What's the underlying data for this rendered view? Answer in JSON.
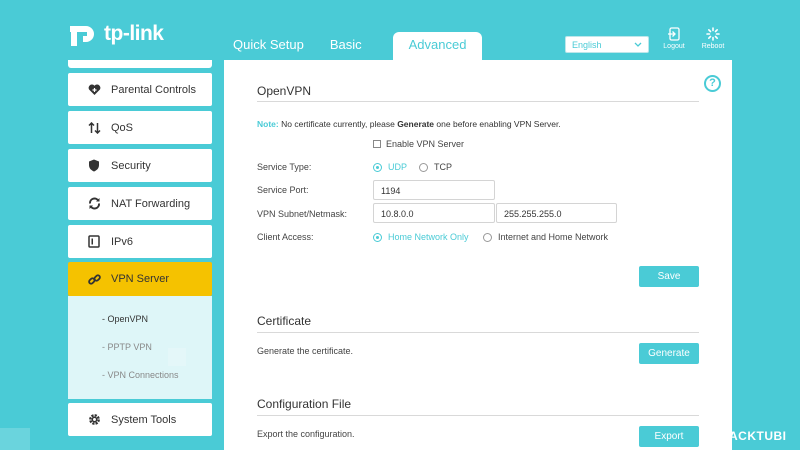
{
  "header": {
    "brand": "tp-link",
    "tabs": [
      {
        "label": "Quick Setup"
      },
      {
        "label": "Basic"
      },
      {
        "label": "Advanced"
      }
    ],
    "language": "English",
    "logout_label": "Logout",
    "reboot_label": "Reboot"
  },
  "sidebar": {
    "items": [
      {
        "label": "Parental Controls",
        "icon": "heart-icon"
      },
      {
        "label": "QoS",
        "icon": "arrows-updown-icon"
      },
      {
        "label": "Security",
        "icon": "shield-icon"
      },
      {
        "label": "NAT Forwarding",
        "icon": "refresh-icon"
      },
      {
        "label": "IPv6",
        "icon": "ipv6-icon"
      },
      {
        "label": "VPN Server",
        "icon": "link-icon"
      },
      {
        "label": "System Tools",
        "icon": "gear-icon"
      }
    ],
    "submenu": [
      {
        "label": "- OpenVPN"
      },
      {
        "label": "- PPTP VPN"
      },
      {
        "label": "- VPN Connections"
      }
    ]
  },
  "openvpn": {
    "title": "OpenVPN",
    "note_label": "Note:",
    "note_pre": "No certificate currently, please",
    "note_bold": "Generate",
    "note_post": "one before enabling VPN Server.",
    "enable_label": "Enable VPN Server",
    "service_type_label": "Service Type:",
    "udp_label": "UDP",
    "tcp_label": "TCP",
    "service_port_label": "Service Port:",
    "service_port_value": "1194",
    "subnet_label": "VPN Subnet/Netmask:",
    "subnet_value": "10.8.0.0",
    "netmask_value": "255.255.255.0",
    "client_access_label": "Client Access:",
    "access_home_label": "Home Network Only",
    "access_internet_label": "Internet and Home Network",
    "save_label": "Save"
  },
  "certificate": {
    "title": "Certificate",
    "desc": "Generate the certificate.",
    "button_label": "Generate"
  },
  "config_file": {
    "title": "Configuration File",
    "desc": "Export the configuration.",
    "button_label": "Export"
  },
  "watermark": "BLACKTUBI",
  "colors": {
    "accent": "#4acbd6",
    "active": "#f5c200"
  }
}
